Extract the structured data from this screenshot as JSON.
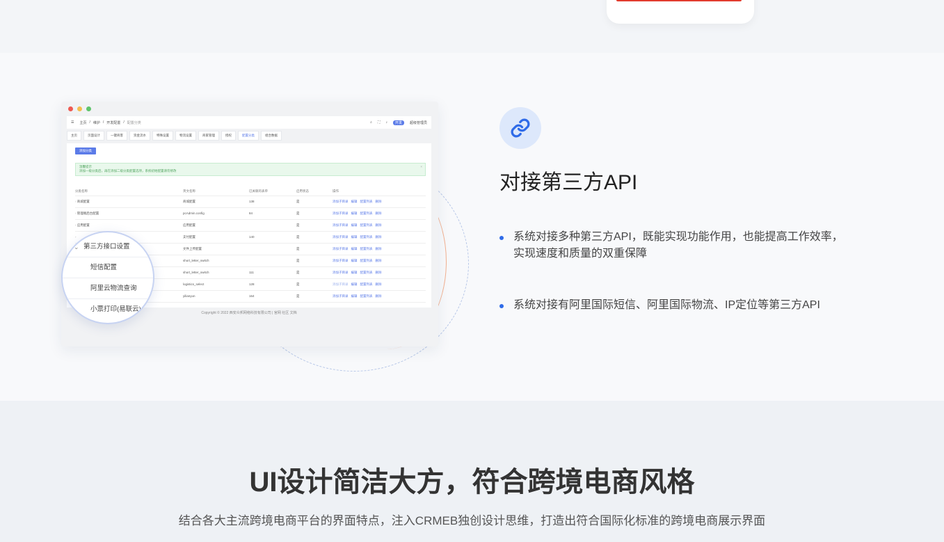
{
  "colors": {
    "accent": "#5b7be8",
    "link_icon": "#2f6be8",
    "red_bar": "#e23b2e"
  },
  "admin": {
    "header": {
      "crumbs": [
        "主页",
        "维护",
        "开发配置",
        "配置分类"
      ],
      "badge": "开发",
      "user": "超级管理员"
    },
    "tabs": [
      "主页",
      "页面设计",
      "一键商客",
      "资金流水",
      "特殊设置",
      "物流设置",
      "商家管理",
      "授权",
      "配置分类",
      "组合数据"
    ],
    "active_tab_index": 8,
    "add_button": "添加分类",
    "alert": {
      "title": "温馨提示",
      "text": "添加一级分类后，再在添加二级分类配置选项，系统初始配置请勿修改"
    },
    "columns": [
      "分类名称",
      "英文名称",
      "已关联的表单",
      "启用状态",
      "操作"
    ],
    "rows": [
      {
        "name": "商城配置",
        "en": "商城配置",
        "count": "138",
        "status": "是",
        "dim": false
      },
      {
        "name": "管理端后台配置",
        "en": "pcAdmin.config",
        "count": "84",
        "status": "是",
        "dim": false
      },
      {
        "name": "应用配置",
        "en": "应用配置",
        "count": "",
        "status": "是",
        "dim": false
      },
      {
        "name": "",
        "en": "支付配置",
        "count": "140",
        "status": "是",
        "dim": false
      },
      {
        "name": "",
        "en": "文件上传配置",
        "count": "",
        "status": "是",
        "dim": false
      },
      {
        "name": "",
        "en": "short_letter_switch",
        "count": "",
        "status": "是",
        "dim": false
      },
      {
        "name": "",
        "en": "short_letter_switch",
        "count": "111",
        "status": "是",
        "dim": false
      },
      {
        "name": "",
        "en": "logistics_select",
        "count": "128",
        "status": "是",
        "dim": true
      },
      {
        "name": "",
        "en": "yilianyun",
        "count": "164",
        "status": "是",
        "dim": false
      }
    ],
    "ops": [
      "添加子目录",
      "编辑",
      "配置列表",
      "删除"
    ],
    "footer": "Copyright © 2022 西安众邦网络科技有限公司 | 官网 社区 文档"
  },
  "zoom_menu": {
    "parent": "第三方接口设置",
    "children": [
      "短信配置",
      "阿里云物流查询",
      "小票打印(易联云)"
    ]
  },
  "feature": {
    "icon": "link-icon",
    "title": "对接第三方API",
    "bullets": [
      "系统对接多种第三方API，既能实现功能作用，也能提高工作效率，实现速度和质量的双重保障",
      "系统对接有阿里国际短信、阿里国际物流、IP定位等第三方API"
    ]
  },
  "section": {
    "title": "UI设计简洁大方，符合跨境电商风格",
    "subtitle": "结合各大主流跨境电商平台的界面特点，注入CRMEB独创设计思维，打造出符合国际化标准的跨境电商展示界面"
  }
}
